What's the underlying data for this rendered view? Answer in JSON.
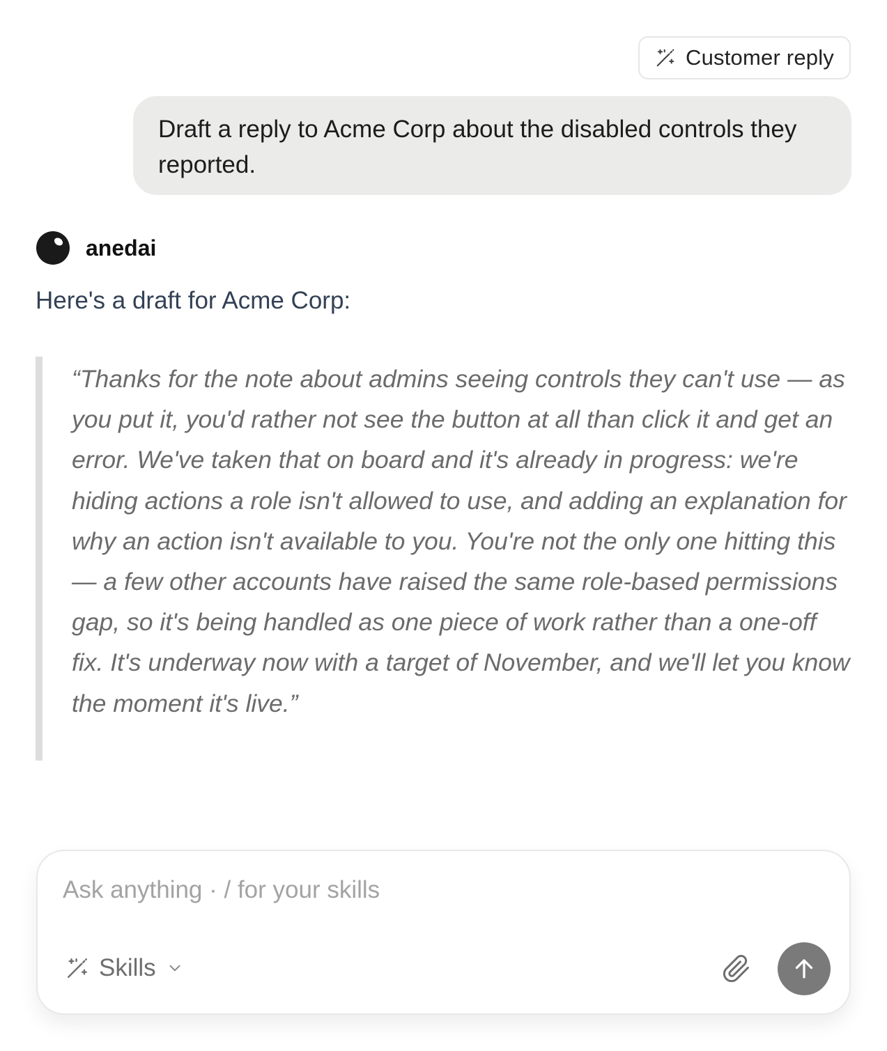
{
  "skill_chip": {
    "icon": "magic-wand-icon",
    "label": "Customer reply"
  },
  "user_message": {
    "text": "Draft a reply to Acme Corp about the disabled controls they reported."
  },
  "assistant": {
    "avatar_icon": "anedai-avatar-icon",
    "name": "anedai",
    "intro": "Here's a draft for Acme Corp:",
    "quote": "“Thanks for the note about admins seeing controls they can't use — as you put it, you'd rather not see the button at all than click it and get an error. We've taken that on board and it's already in progress: we're hiding actions a role isn't allowed to use, and adding an explanation for why an action isn't available to you. You're not the only one hitting this — a few other accounts have raised the same role-based permissions gap, so it's being handled as one piece of work rather than a one-off fix. It's underway now with a target of November, and we'll let you know the moment it's live.”"
  },
  "composer": {
    "placeholder": "Ask anything · / for your skills",
    "skills_label": "Skills",
    "skills_icon": "magic-wand-icon",
    "dropdown_icon": "chevron-down-icon",
    "attach_icon": "paperclip-icon",
    "send_icon": "arrow-up-icon",
    "send_color": "#7a7a7a"
  }
}
